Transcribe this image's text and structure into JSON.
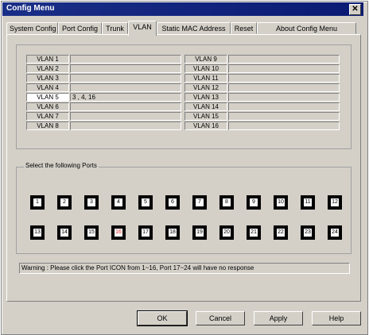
{
  "window": {
    "title": "Config Menu",
    "close_glyph": "✕"
  },
  "tabs": [
    {
      "label": "System Config"
    },
    {
      "label": "Port Config"
    },
    {
      "label": "Trunk"
    },
    {
      "label": "VLAN"
    },
    {
      "label": "Static MAC Address"
    },
    {
      "label": "Reset"
    },
    {
      "label": "About Config Menu"
    }
  ],
  "active_tab": "VLAN",
  "vlans": [
    {
      "label": "VLAN 1",
      "value": ""
    },
    {
      "label": "VLAN 2",
      "value": ""
    },
    {
      "label": "VLAN 3",
      "value": ""
    },
    {
      "label": "VLAN 4",
      "value": ""
    },
    {
      "label": "VLAN 5",
      "value": "3 , 4, 16"
    },
    {
      "label": "VLAN 6",
      "value": ""
    },
    {
      "label": "VLAN 7",
      "value": ""
    },
    {
      "label": "VLAN 8",
      "value": ""
    },
    {
      "label": "VLAN 9",
      "value": ""
    },
    {
      "label": "VLAN 10",
      "value": ""
    },
    {
      "label": "VLAN 11",
      "value": ""
    },
    {
      "label": "VLAN 12",
      "value": ""
    },
    {
      "label": "VLAN 13",
      "value": ""
    },
    {
      "label": "VLAN 14",
      "value": ""
    },
    {
      "label": "VLAN 15",
      "value": ""
    },
    {
      "label": "VLAN 16",
      "value": ""
    }
  ],
  "selected_vlan": "VLAN 5",
  "ports_group_label": "Select the following Ports",
  "ports": [
    "1",
    "2",
    "3",
    "4",
    "5",
    "6",
    "7",
    "8",
    "9",
    "10",
    "11",
    "12",
    "13",
    "14",
    "15",
    "16",
    "17",
    "18",
    "19",
    "20",
    "21",
    "22",
    "23",
    "24"
  ],
  "highlighted_port": "16",
  "warning": "Warning : Please click the Port  ICON from 1~16,  Port 17~24 will have no response",
  "buttons": {
    "ok": "OK",
    "cancel": "Cancel",
    "apply": "Apply",
    "help": "Help"
  },
  "colors": {
    "title_bar": "#1a2f87",
    "face": "#d4d0c8",
    "highlight_port_text": "#e02020"
  }
}
